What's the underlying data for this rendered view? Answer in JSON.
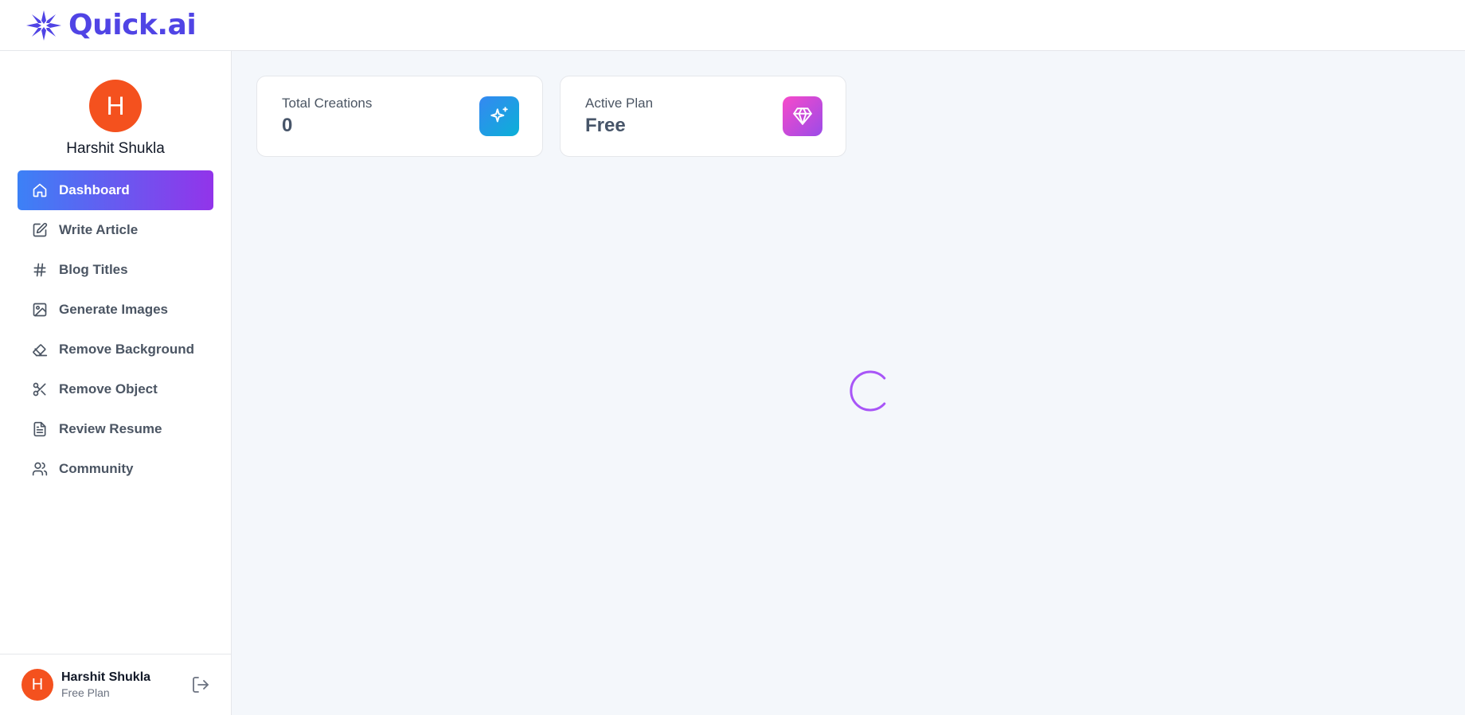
{
  "app": {
    "name": "Quick.ai"
  },
  "profile": {
    "initial": "H",
    "name": "Harshit Shukla"
  },
  "nav": {
    "items": [
      {
        "label": "Dashboard",
        "icon": "home-icon",
        "active": true
      },
      {
        "label": "Write Article",
        "icon": "edit-icon"
      },
      {
        "label": "Blog Titles",
        "icon": "hash-icon"
      },
      {
        "label": "Generate Images",
        "icon": "image-icon"
      },
      {
        "label": "Remove Background",
        "icon": "eraser-icon"
      },
      {
        "label": "Remove Object",
        "icon": "scissors-icon"
      },
      {
        "label": "Review Resume",
        "icon": "file-text-icon"
      },
      {
        "label": "Community",
        "icon": "users-icon"
      }
    ]
  },
  "footer": {
    "initial": "H",
    "name": "Harshit Shukla",
    "plan": "Free Plan",
    "icon": "logout-icon"
  },
  "stats": {
    "total_creations": {
      "label": "Total Creations",
      "value": "0",
      "icon": "sparkles-icon"
    },
    "active_plan": {
      "label": "Active Plan",
      "value": "Free",
      "icon": "gem-icon"
    }
  },
  "loader": {
    "icon": "spinner-icon"
  },
  "colors": {
    "brand": "#5044e5",
    "active_gradient_start": "#3c81f6",
    "active_gradient_end": "#9234ea",
    "avatar": "#f4511e",
    "spinner": "#a855f7"
  }
}
